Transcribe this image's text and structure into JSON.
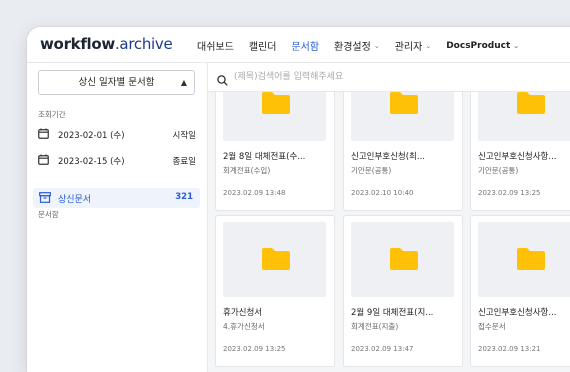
{
  "header": {
    "logo_bold": "workflow",
    "logo_light": ".archive",
    "nav": [
      {
        "label": "대쉬보드",
        "active": false,
        "dropdown": false
      },
      {
        "label": "캘린더",
        "active": false,
        "dropdown": false
      },
      {
        "label": "문서함",
        "active": true,
        "dropdown": false
      },
      {
        "label": "환경설정",
        "active": false,
        "dropdown": true
      },
      {
        "label": "관리자",
        "active": false,
        "dropdown": true
      },
      {
        "label": "DocsProduct",
        "active": false,
        "dropdown": true
      }
    ]
  },
  "sidebar": {
    "select_value": "상신 일자별 문서함",
    "period_label": "조회기간",
    "start_date": "2023-02-01 (수)",
    "start_tag": "시작일",
    "end_date": "2023-02-15 (수)",
    "end_tag": "종료일",
    "box_section_label": "문서함",
    "box_label": "상신문서",
    "box_count": "321"
  },
  "search": {
    "placeholder": "(제목)검색어를 입력해주세요"
  },
  "cards": [
    {
      "title": "2월 8일 대체전표(수...",
      "sub": "회계전표(수입)",
      "date": "2023.02.09 13:48"
    },
    {
      "title": "신고인부호신청(최...",
      "sub": "기안문(공통)",
      "date": "2023.02.10 10:40"
    },
    {
      "title": "신고인부호신청사항...",
      "sub": "기안문(공통)",
      "date": "2023.02.09 13:25"
    },
    {
      "title": "휴가신청서",
      "sub": "4.휴가신청서",
      "date": "2023.02.09 13:25"
    },
    {
      "title": "2월 9일 대체전표(지...",
      "sub": "회계전표(지출)",
      "date": "2023.02.09 13:47"
    },
    {
      "title": "신고인부호신청사항...",
      "sub": "접수문서",
      "date": "2023.02.09 13:21"
    }
  ],
  "colors": {
    "accent": "#2a5bd7",
    "folder": "#ffc107",
    "selected_bg": "#eef3fc"
  }
}
